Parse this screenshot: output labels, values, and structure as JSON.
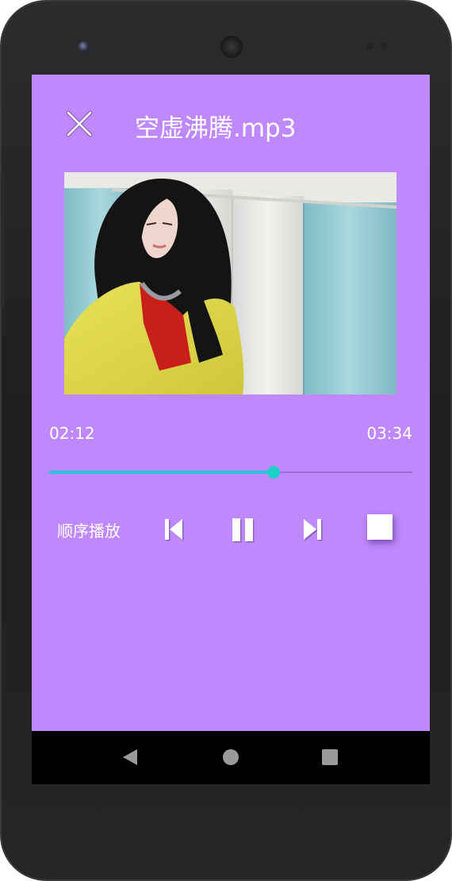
{
  "player": {
    "title": "空虚沸腾.mp3",
    "current_time": "02:12",
    "total_time": "03:34",
    "progress_fraction": 0.617,
    "play_mode": "顺序播放"
  },
  "icons": {
    "close": "close-icon",
    "previous": "skip-previous-icon",
    "pause": "pause-icon",
    "next": "skip-next-icon",
    "stop": "stop-icon",
    "nav_back": "back-triangle-icon",
    "nav_home": "home-circle-icon",
    "nav_recents": "recents-square-icon"
  },
  "colors": {
    "background": "#bf88fc",
    "accent": "#1bd1c8",
    "text": "#ffffff"
  }
}
